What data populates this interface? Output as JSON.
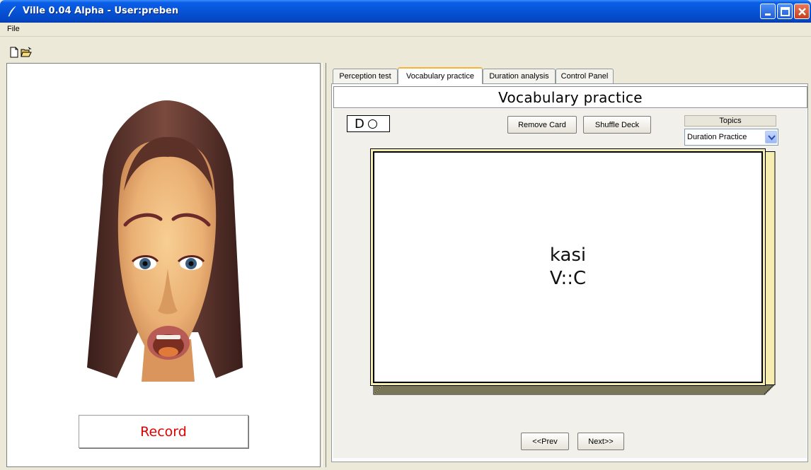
{
  "window": {
    "title": "Ville 0.04 Alpha - User:preben"
  },
  "menu": {
    "file": "File"
  },
  "toolbar": {
    "new_icon": "new-document-icon",
    "open_icon": "open-folder-icon"
  },
  "left_panel": {
    "record_label": "Record"
  },
  "tabs": [
    {
      "label": "Perception test"
    },
    {
      "label": "Vocabulary practice",
      "active": true
    },
    {
      "label": "Duration analysis"
    },
    {
      "label": "Control Panel"
    }
  ],
  "vocab": {
    "title": "Vocabulary practice",
    "indicator_letter": "D",
    "remove_card": "Remove Card",
    "shuffle_deck": "Shuffle Deck",
    "topics_label": "Topics",
    "topic_selected": "Duration Practice",
    "card_word": "kasi",
    "card_pattern": "V::C",
    "prev": "<<Prev",
    "next": "Next>>"
  },
  "colors": {
    "record_text": "#e00000",
    "card_border": "#f5eeb0",
    "active_tab_accent": "#f9b233"
  }
}
